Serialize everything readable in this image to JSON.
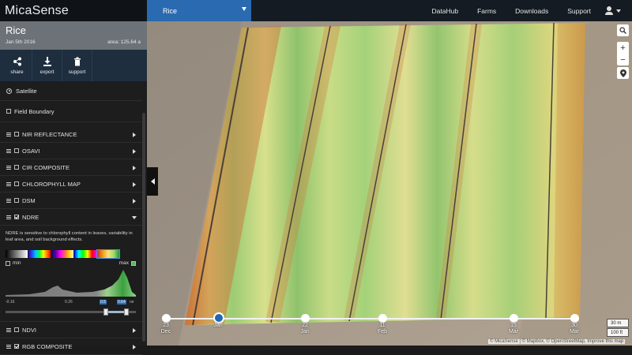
{
  "topbar": {
    "logo": "MicaSense",
    "field_selector": "Rice",
    "nav": [
      "DataHub",
      "Farms",
      "Downloads",
      "Support"
    ]
  },
  "field": {
    "title": "Rice",
    "date": "Jan 5th 2016",
    "area": "area: 125.64 a"
  },
  "actions": [
    {
      "label": "share",
      "icon": "share-icon"
    },
    {
      "label": "export",
      "icon": "download-icon"
    },
    {
      "label": "support",
      "icon": "trash-icon"
    }
  ],
  "layers": {
    "satellite": "Satellite",
    "field_boundary": "Field Boundary",
    "nir": "NIR REFLECTANCE",
    "osavi": "OSAVI",
    "cir": "CIR COMPOSITE",
    "chlorophyll": "CHLOROPHYLL MAP",
    "dsm": "DSM",
    "ndre": "NDRE",
    "ndvi": "NDVI",
    "rgb": "RGB COMPOSITE"
  },
  "ndre": {
    "description": "NDRE is sensitive to chlorophyll content in leaves, variability in leaf area, and soil background effects.",
    "min_label": "min",
    "max_label": "max",
    "axis": [
      "-0.16",
      "0.26",
      "0.5",
      "0.64"
    ],
    "axis_suffix": "ne",
    "range_low": 0.5,
    "range_high": 0.64
  },
  "timeline": {
    "dates": [
      {
        "day": "23",
        "month": "Dec"
      },
      {
        "day": "",
        "month": "Jan"
      },
      {
        "day": "22",
        "month": "Jan"
      },
      {
        "day": "11",
        "month": "Feb"
      },
      {
        "day": "15",
        "month": "Mar"
      },
      {
        "day": "30",
        "month": "Mar"
      }
    ],
    "selected_index": 1
  },
  "map": {
    "zoom_in": "+",
    "zoom_out": "−",
    "scale_metric": "30 m",
    "scale_imperial": "100 ft",
    "attribution": "© MicaSense | © Mapbox, © OpenStreetMap, Improve this map"
  },
  "colors": {
    "accent": "#2a6ab0",
    "header_bg": "#141b22",
    "field_header": "#6c7277",
    "actions_bg": "#1f2e3e"
  }
}
